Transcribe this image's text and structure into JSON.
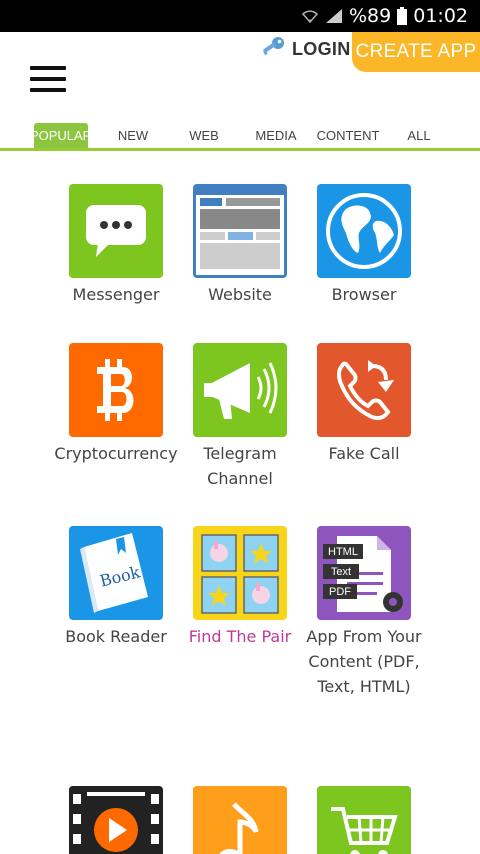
{
  "status_bar": {
    "battery_text": "%89",
    "time": "01:02"
  },
  "header": {
    "login_label": "LOGIN",
    "create_app_label": "CREATE APP"
  },
  "tabs": [
    {
      "label": "POPULAR",
      "active": true
    },
    {
      "label": "NEW"
    },
    {
      "label": "WEB"
    },
    {
      "label": "MEDIA"
    },
    {
      "label": "CONTENT"
    },
    {
      "label": "ALL"
    }
  ],
  "apps": [
    {
      "label": "Messenger",
      "icon": "chat-bubble-icon",
      "color": "#7dc51f"
    },
    {
      "label": "Website",
      "icon": "webpage-icon",
      "color": "#3f7fc2"
    },
    {
      "label": "Browser",
      "icon": "globe-icon",
      "color": "#1b96e6"
    },
    {
      "label": "Cryptocurrency",
      "icon": "bitcoin-icon",
      "color": "#ff6a00"
    },
    {
      "label": "Telegram Channel",
      "icon": "megaphone-icon",
      "color": "#7dc51f"
    },
    {
      "label": "Fake Call",
      "icon": "phone-callback-icon",
      "color": "#e2572b"
    },
    {
      "label": "Book Reader",
      "icon": "book-icon",
      "color": "#1b96e6"
    },
    {
      "label": "Find The Pair",
      "icon": "cards-icon",
      "color": "#f9d51a",
      "label_color": "#c0399a"
    },
    {
      "label": "App From Your Content (PDF, Text, HTML)",
      "icon": "document-icon",
      "color": "#8f55bf",
      "chips": [
        "HTML",
        "Text",
        "PDF"
      ]
    },
    {
      "label": "",
      "icon": "video-film-icon",
      "color": "#222222"
    },
    {
      "label": "",
      "icon": "music-note-icon",
      "color": "#ff9e1a"
    },
    {
      "label": "",
      "icon": "shopping-cart-icon",
      "color": "#7dc51f"
    }
  ]
}
